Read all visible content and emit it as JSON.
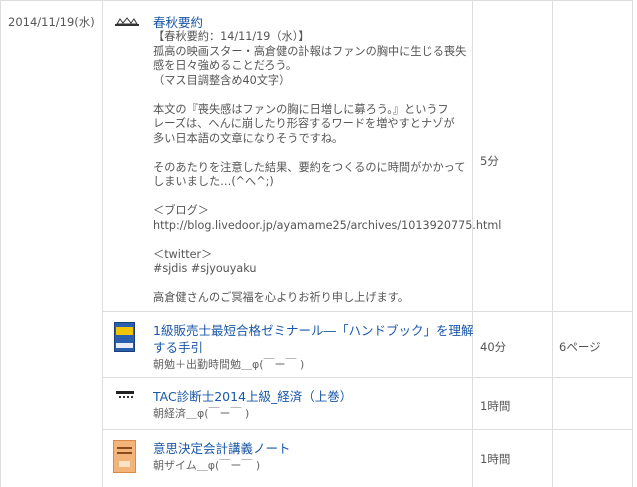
{
  "date": "2014/11/19(水)",
  "rows": [
    {
      "title": "春秋要約",
      "description_lines": [
        "【春秋要約：14/11/19（水）】",
        "孤高の映画スター・高倉健の訃報はファンの胸中に生じる喪失",
        "感を日々強めることだろう。",
        "（マス目調整含め40文字）",
        "",
        "本文の『喪失感はファンの胸に日増しに募ろう。』というフ",
        "レーズは、へんに崩したり形容するワードを増やすとナゾが",
        "多い日本語の文章になりそうですね。",
        "",
        "そのあたりを注意した結果、要約をつくるのに時間がかかって",
        "しまいました…(^へ^;)",
        "",
        "＜ブログ＞",
        "http://blog.livedoor.jp/ayamame25/archives/1013920775.html",
        "",
        "＜twitter＞",
        "#sjdis #sjyouyaku",
        "",
        "高倉健さんのご冥福を心よりお祈り申し上げます。"
      ],
      "time": "5分",
      "pages": ""
    },
    {
      "title_line1": "1級販売士最短合格ゼミナール―「ハンドブック」を理解",
      "title_line2": "する手引",
      "subtitle": "朝勉＋出勤時間勉＿φ(￣ー￣ )",
      "time": "40分",
      "pages": "6ページ"
    },
    {
      "title": "TAC診断士2014上級_経済（上巻）",
      "subtitle": "朝経済＿φ(￣ー￣ )",
      "time": "1時間",
      "pages": ""
    },
    {
      "title": "意思決定会計講義ノート",
      "subtitle": "朝ザイム＿φ(￣ー￣ )",
      "time": "1時間",
      "pages": ""
    }
  ]
}
